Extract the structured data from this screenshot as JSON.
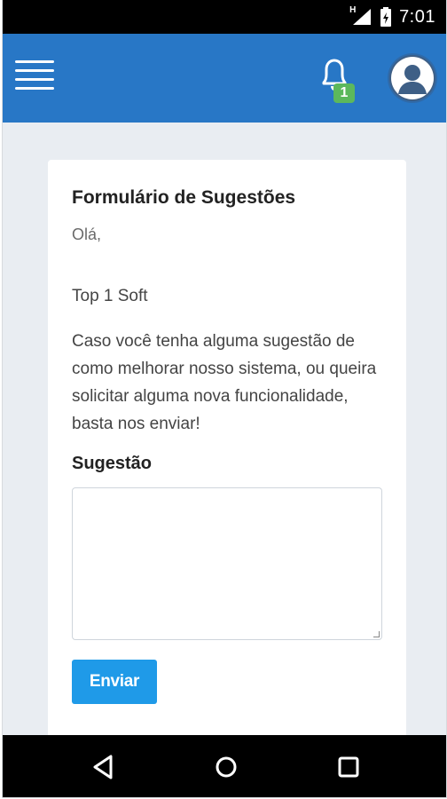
{
  "status_bar": {
    "time": "7:01",
    "network": "H"
  },
  "app_bar": {
    "menu_icon": "hamburger-icon",
    "notification_icon": "bell-icon",
    "notification_count": "1",
    "avatar_icon": "user-avatar-icon"
  },
  "form": {
    "title": "Formulário de Sugestões",
    "greeting": "Olá,",
    "company": "Top 1 Soft",
    "description": "Caso você tenha alguma sugestão de como melhorar nosso sistema, ou queira solicitar alguma nova funcionalidade, basta nos enviar!",
    "field_label": "Sugestão",
    "field_value": "",
    "submit_label": "Enviar"
  },
  "nav_bar": {
    "back_icon": "back-triangle-icon",
    "home_icon": "home-circle-icon",
    "recents_icon": "recents-square-icon"
  },
  "colors": {
    "app_bar": "#2877c6",
    "page_background": "#e9edf2",
    "button": "#1f9ae8",
    "badge": "#5cb85c"
  }
}
